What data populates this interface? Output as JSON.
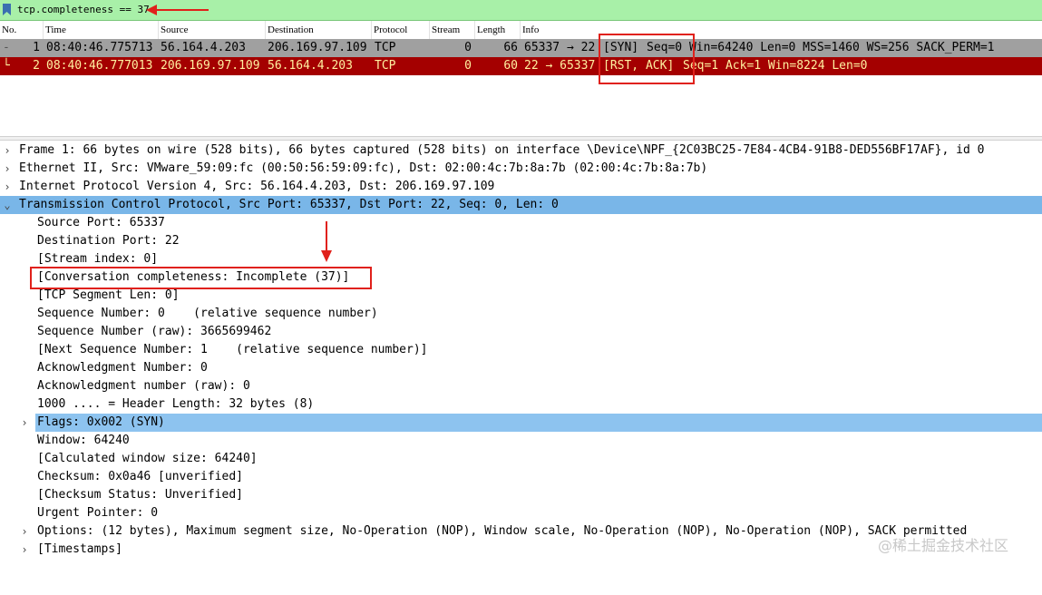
{
  "filter": {
    "expression": "tcp.completeness == 37"
  },
  "columns": [
    "No.",
    "Time",
    "Source",
    "Destination",
    "Protocol",
    "Stream",
    "Length",
    "Info"
  ],
  "packets": [
    {
      "no": "1",
      "time": "08:40:46.775713",
      "source": "56.164.4.203",
      "destination": "206.169.97.109",
      "protocol": "TCP",
      "stream": "0",
      "length": "66",
      "info_ports": "65337 → 22",
      "info_flags": "[SYN]",
      "info_rest": "Seq=0 Win=64240 Len=0 MSS=1460 WS=256 SACK_PERM=1"
    },
    {
      "no": "2",
      "time": "08:40:46.777013",
      "source": "206.169.97.109",
      "destination": "56.164.4.203",
      "protocol": "TCP",
      "stream": "0",
      "length": "60",
      "info_ports": "22 → 65337",
      "info_flags": "[RST, ACK]",
      "info_rest": "Seq=1 Ack=1 Win=8224 Len=0"
    }
  ],
  "details": {
    "frame": "Frame 1: 66 bytes on wire (528 bits), 66 bytes captured (528 bits) on interface \\Device\\NPF_{2C03BC25-7E84-4CB4-91B8-DED556BF17AF}, id 0",
    "ethernet": "Ethernet II, Src: VMware_59:09:fc (00:50:56:59:09:fc), Dst: 02:00:4c:7b:8a:7b (02:00:4c:7b:8a:7b)",
    "ip": "Internet Protocol Version 4, Src: 56.164.4.203, Dst: 206.169.97.109",
    "tcp": "Transmission Control Protocol, Src Port: 65337, Dst Port: 22, Seq: 0, Len: 0",
    "tcp_fields": [
      "Source Port: 65337",
      "Destination Port: 22",
      "[Stream index: 0]",
      "[Conversation completeness: Incomplete (37)]",
      "[TCP Segment Len: 0]",
      "Sequence Number: 0    (relative sequence number)",
      "Sequence Number (raw): 3665699462",
      "[Next Sequence Number: 1    (relative sequence number)]",
      "Acknowledgment Number: 0",
      "Acknowledgment number (raw): 0",
      "1000 .... = Header Length: 32 bytes (8)",
      "Flags: 0x002 (SYN)",
      "Window: 64240",
      "[Calculated window size: 64240]",
      "Checksum: 0x0a46 [unverified]",
      "[Checksum Status: Unverified]",
      "Urgent Pointer: 0",
      "Options: (12 bytes), Maximum segment size, No-Operation (NOP), Window scale, No-Operation (NOP), No-Operation (NOP), SACK permitted",
      "[Timestamps]"
    ]
  },
  "watermark": "@稀土掘金技术社区",
  "colors": {
    "filter_bg": "#a8f0a8",
    "row_normal": "#a0a0a0",
    "row_rst": "#a40000",
    "row_rst_text": "#fff0a0",
    "selection": "#79b6e8",
    "annotation": "#e0211b"
  },
  "icons": {
    "filter": "bookmark-icon",
    "expanded": "chevron-down-icon",
    "collapsed": "chevron-right-icon"
  }
}
